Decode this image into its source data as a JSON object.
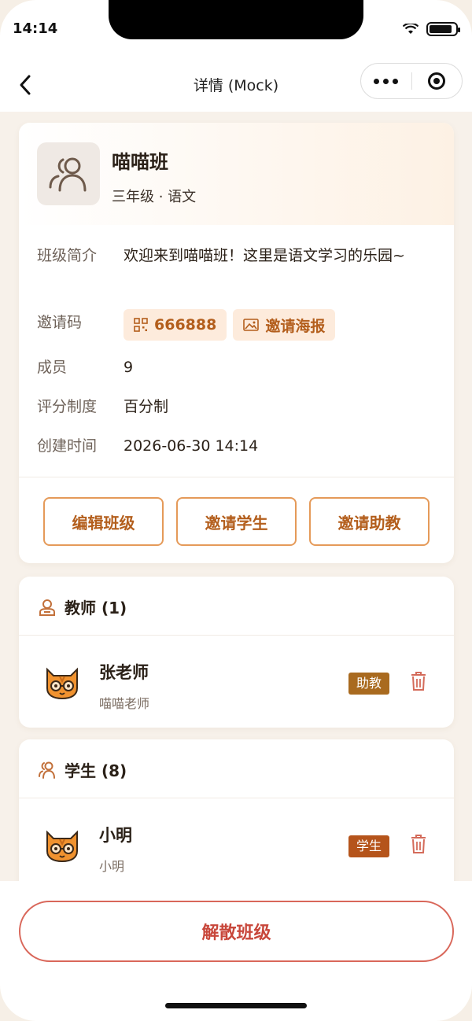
{
  "status": {
    "time": "14:14"
  },
  "nav": {
    "title": "详情 (Mock)"
  },
  "class_info": {
    "name": "喵喵班",
    "subtitle": "三年级 · 语文",
    "rows": {
      "intro_label": "班级简介",
      "intro_value": "欢迎来到喵喵班！这里是语文学习的乐园~",
      "invite_label": "邀请码",
      "invite_code": "666888",
      "invite_poster": "邀请海报",
      "members_label": "成员",
      "members_value": "9",
      "grading_label": "评分制度",
      "grading_value": "百分制",
      "created_label": "创建时间",
      "created_value": "2026-06-30 14:14"
    },
    "actions": {
      "edit": "编辑班级",
      "invite_student": "邀请学生",
      "invite_assistant": "邀请助教"
    }
  },
  "teachers": {
    "title": "教师 (1)",
    "items": [
      {
        "name": "张老师",
        "nickname": "喵喵老师",
        "role": "助教"
      }
    ]
  },
  "students": {
    "title": "学生 (8)",
    "items": [
      {
        "name": "小明",
        "nickname": "小明",
        "role": "学生"
      }
    ]
  },
  "footer": {
    "dissolve": "解散班级"
  },
  "colors": {
    "accent": "#b35e1c",
    "accent_border": "#e59a59",
    "danger": "#c8473b",
    "assistant_badge": "#a96a1f",
    "student_badge": "#b5541b"
  },
  "icons": [
    "back-arrow-icon",
    "more-dots-icon",
    "target-icon",
    "group-avatar-icon",
    "qr-code-icon",
    "image-icon",
    "teacher-icon",
    "students-icon",
    "cat-avatar-icon",
    "trash-icon"
  ]
}
